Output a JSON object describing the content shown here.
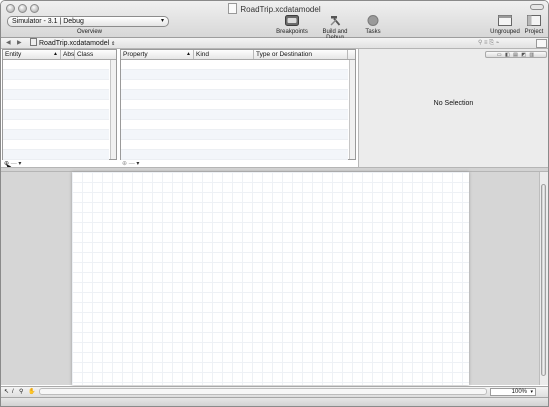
{
  "window": {
    "title": "RoadTrip.xcdatamodel"
  },
  "toolbar": {
    "scheme_popup": "Simulator - 3.1 | Debug",
    "overview_label": "Overview",
    "items": [
      {
        "label": "Breakpoints",
        "icon": "breakpoints-icon"
      },
      {
        "label": "Build and Debug",
        "icon": "hammer-icon"
      },
      {
        "label": "Tasks",
        "icon": "tasks-stop-icon"
      },
      {
        "label": "Ungrouped",
        "icon": "ungrouped-window-icon"
      },
      {
        "label": "Project",
        "icon": "project-window-icon"
      }
    ]
  },
  "navbar": {
    "file_popup": "RoadTrip.xcdatamodel"
  },
  "entity_table": {
    "columns": [
      "Entity",
      "Abs",
      "Class"
    ]
  },
  "property_table": {
    "columns": [
      "Property",
      "Kind",
      "Type or Destination"
    ]
  },
  "inspector": {
    "message": "No Selection"
  },
  "bottom": {
    "zoom": "100%"
  }
}
